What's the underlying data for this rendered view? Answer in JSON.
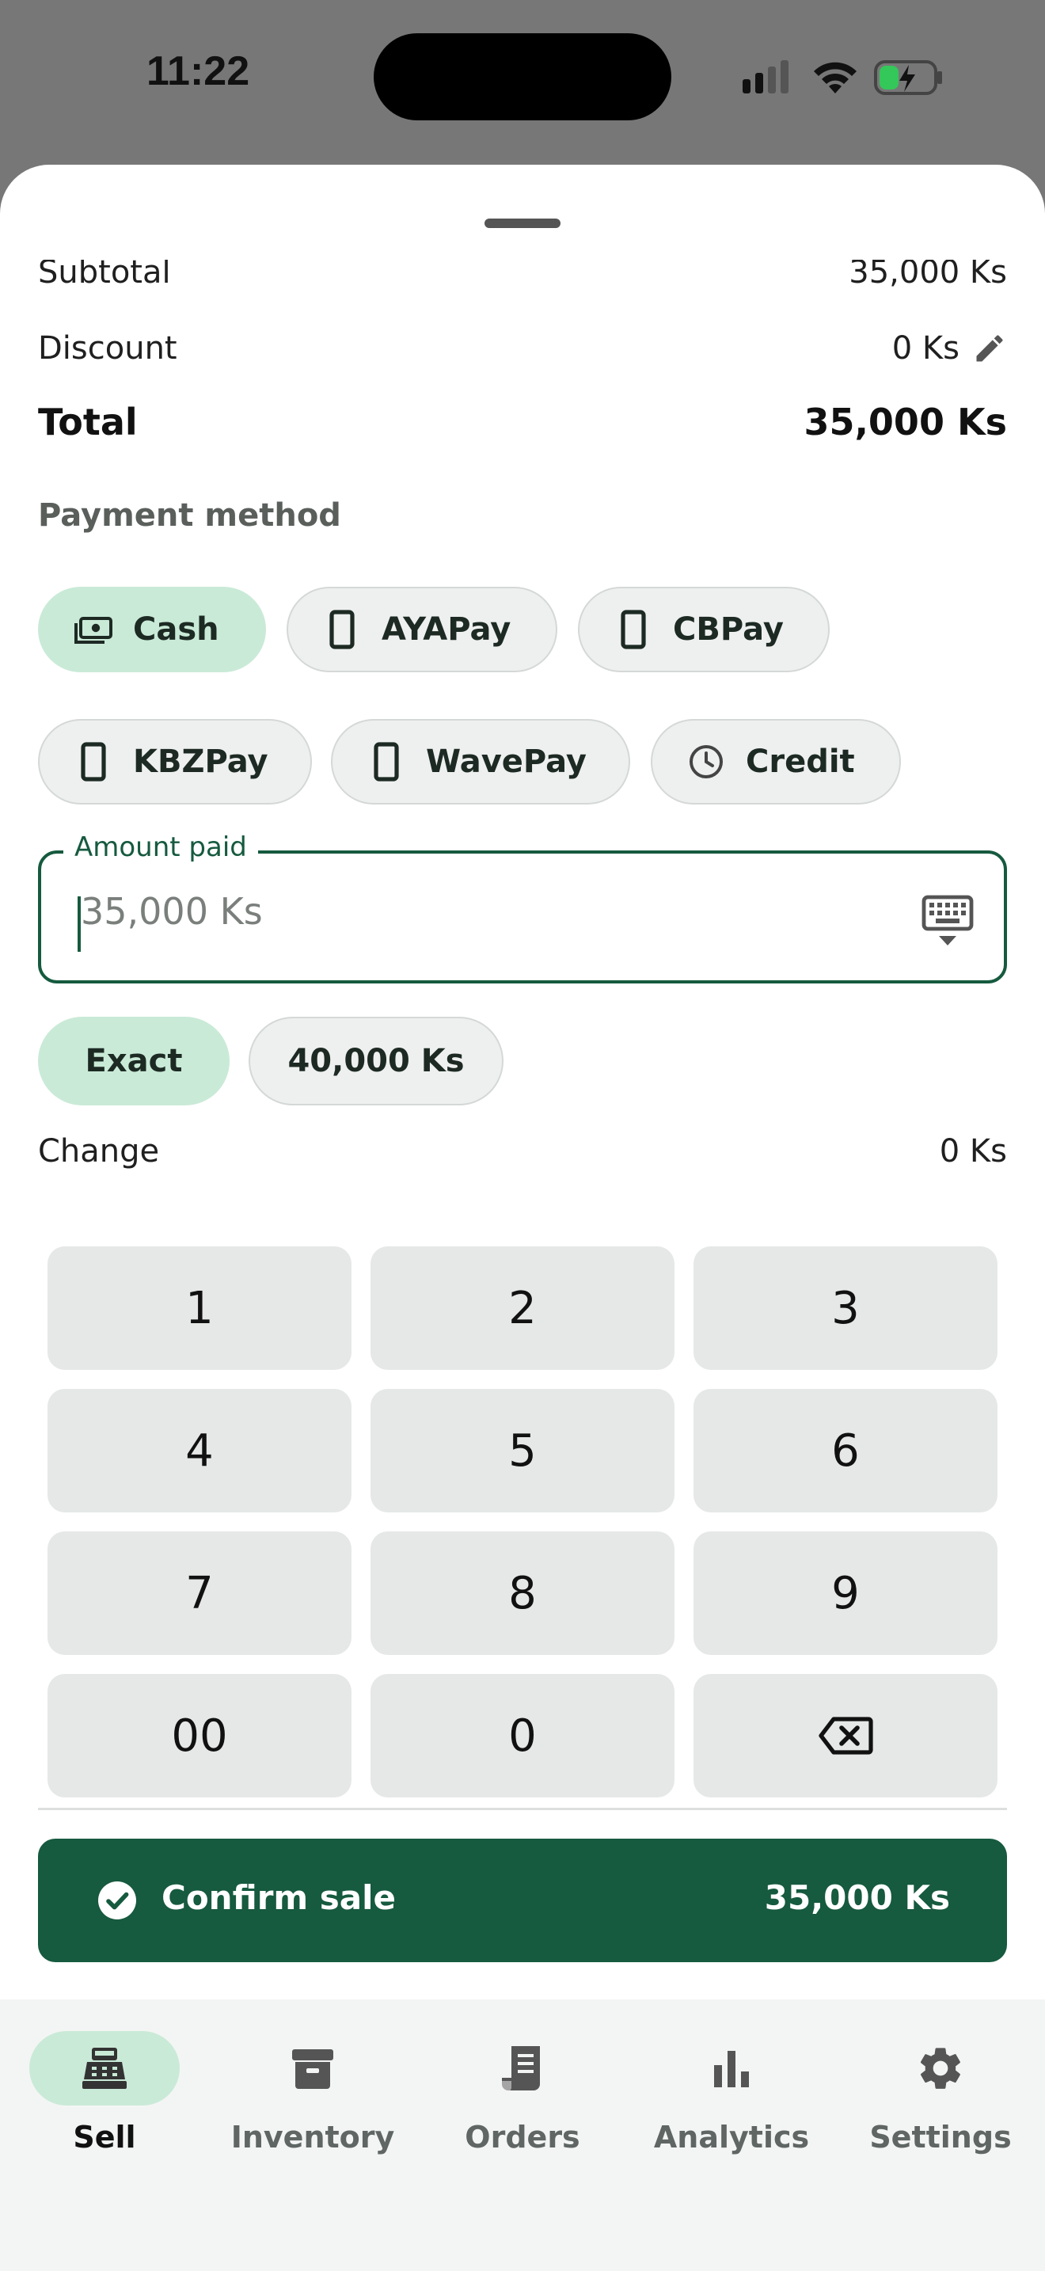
{
  "status_bar": {
    "time": "11:22"
  },
  "summary": {
    "subtotal_label": "Subtotal",
    "subtotal_value": "35,000 Ks",
    "discount_label": "Discount",
    "discount_value": "0 Ks",
    "total_label": "Total",
    "total_value": "35,000 Ks"
  },
  "payment": {
    "title": "Payment method",
    "methods": [
      {
        "label": "Cash",
        "icon": "cash-icon",
        "selected": true
      },
      {
        "label": "AYAPay",
        "icon": "phone-icon",
        "selected": false
      },
      {
        "label": "CBPay",
        "icon": "phone-icon",
        "selected": false
      },
      {
        "label": "KBZPay",
        "icon": "phone-icon",
        "selected": false
      },
      {
        "label": "WavePay",
        "icon": "phone-icon",
        "selected": false
      },
      {
        "label": "Credit",
        "icon": "clock-icon",
        "selected": false
      }
    ]
  },
  "amount": {
    "label": "Amount paid",
    "placeholder": "35,000 Ks"
  },
  "quick_amounts": [
    {
      "label": "Exact",
      "selected": true
    },
    {
      "label": "40,000 Ks",
      "selected": false
    }
  ],
  "change": {
    "label": "Change",
    "value": "0 Ks"
  },
  "keypad": [
    "1",
    "2",
    "3",
    "4",
    "5",
    "6",
    "7",
    "8",
    "9",
    "00",
    "0",
    "backspace-icon"
  ],
  "confirm": {
    "label": "Confirm sale",
    "amount": "35,000 Ks"
  },
  "nav": [
    {
      "label": "Sell",
      "icon": "register-icon",
      "selected": true
    },
    {
      "label": "Inventory",
      "icon": "archive-icon",
      "selected": false
    },
    {
      "label": "Orders",
      "icon": "receipt-icon",
      "selected": false
    },
    {
      "label": "Analytics",
      "icon": "bar-chart-icon",
      "selected": false
    },
    {
      "label": "Settings",
      "icon": "gear-icon",
      "selected": false
    }
  ],
  "colors": {
    "primary": "#165a3f",
    "selected_chip": "#c9ead7",
    "key_bg": "#e5e8e6",
    "nav_bg": "#f3f5f4"
  }
}
